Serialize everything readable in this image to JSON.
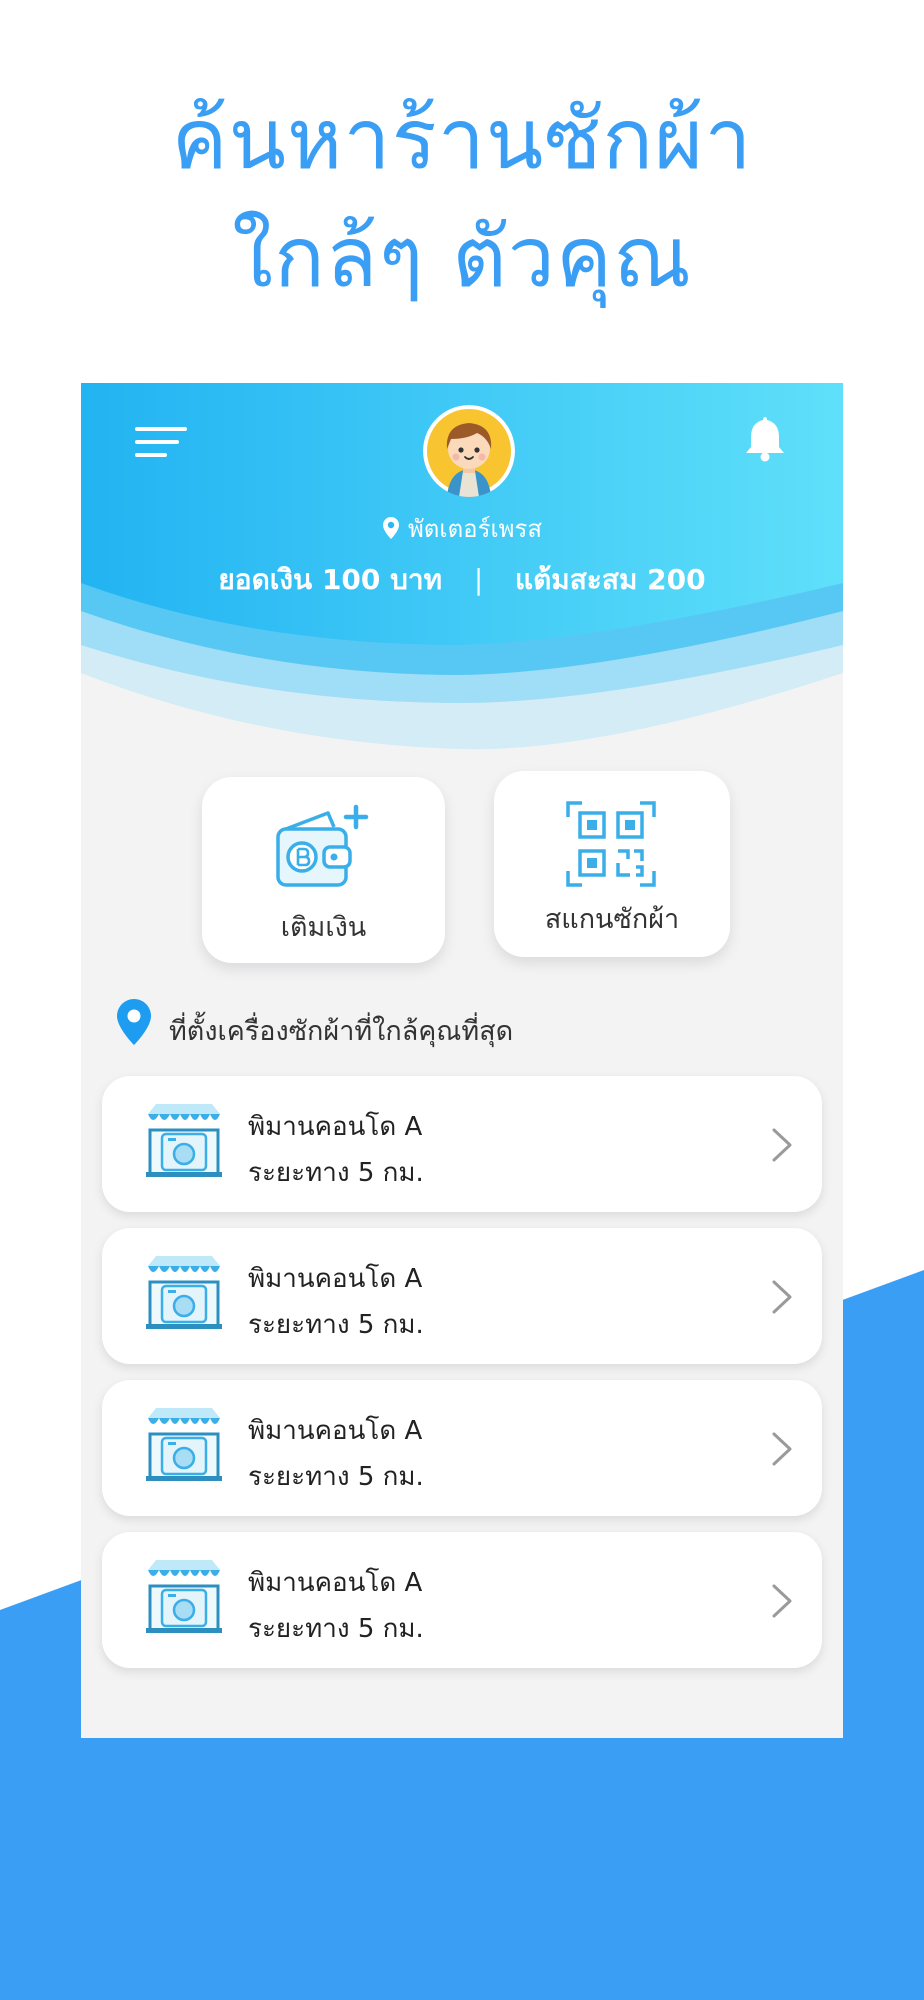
{
  "headline": {
    "line1": "ค้นหาร้านซักผ้า",
    "line2": "ใกล้ๆ ตัวคุณ"
  },
  "colors": {
    "accent": "#3b9ef5",
    "header_gradient_start": "#22b3f2",
    "header_gradient_end": "#5fe0fa",
    "background_wave": "#3b9ef5"
  },
  "header": {
    "menu_icon": "hamburger-menu-icon",
    "bell_icon": "bell-icon",
    "location": "พัตเตอร์เพรส",
    "balance_label": "ยอดเงิน",
    "balance_value": "100",
    "balance_unit": "บาท",
    "separator": "|",
    "points_label": "แต้มสะสม",
    "points_value": "200"
  },
  "actions": {
    "topup_label": "เติมเงิน",
    "scan_label": "สแกนซักผ้า"
  },
  "nearby": {
    "title": "ที่ตั้งเครื่องซักผ้าที่ใกล้คุณที่สุด",
    "items": [
      {
        "name": "พิมานคอนโด A",
        "distance": "ระยะทาง 5 กม."
      },
      {
        "name": "พิมานคอนโด A",
        "distance": "ระยะทาง 5 กม."
      },
      {
        "name": "พิมานคอนโด A",
        "distance": "ระยะทาง 5 กม."
      },
      {
        "name": "พิมานคอนโด A",
        "distance": "ระยะทาง 5 กม."
      }
    ]
  }
}
